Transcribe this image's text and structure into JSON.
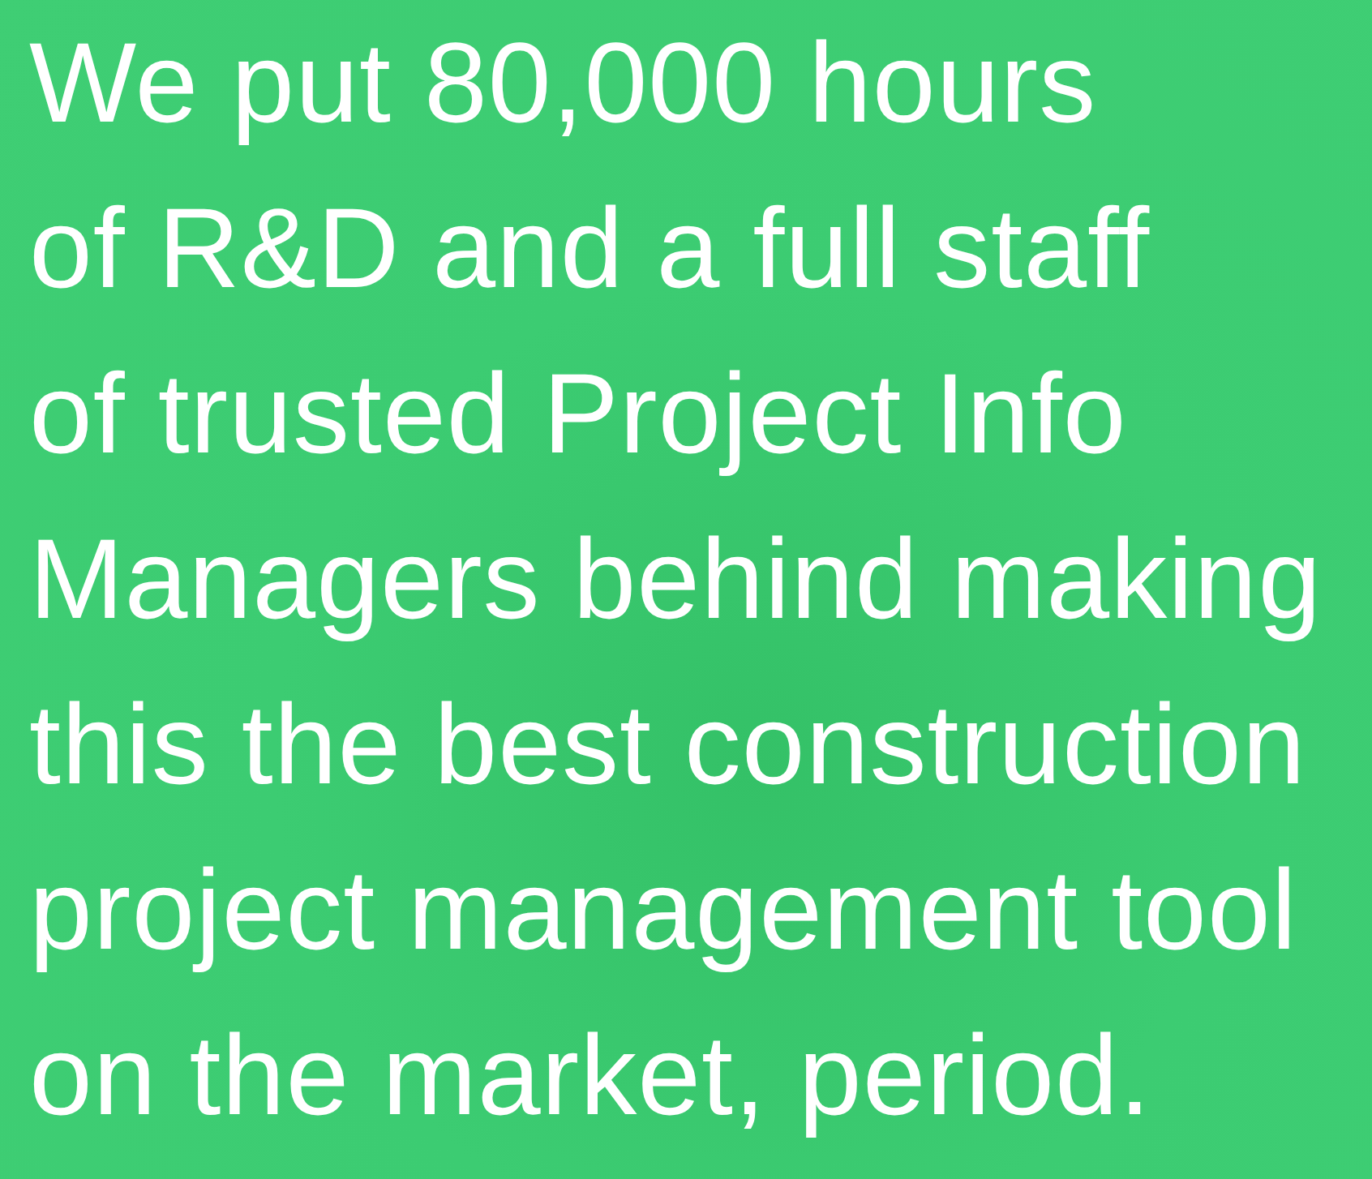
{
  "hero": {
    "text_lines": [
      "We put 80,000 hours",
      "of R&D and a full staff",
      "of trusted Project Info",
      "Managers behind making",
      "this the best construction",
      "project management tool",
      "on the market, period."
    ]
  }
}
